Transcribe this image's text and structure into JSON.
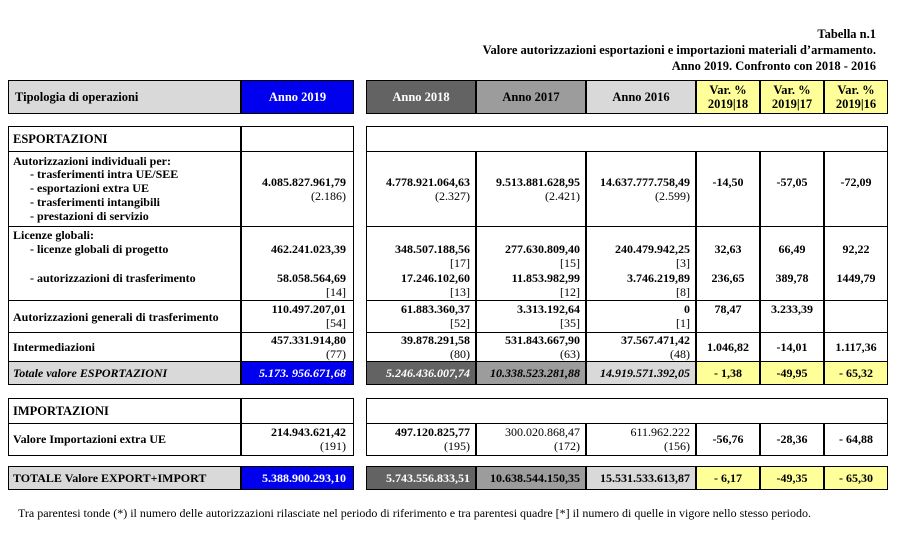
{
  "heading": {
    "line1": "Tabella n.1",
    "line2": "Valore autorizzazioni esportazioni e importazioni materiali d’armamento.",
    "line3": "Anno 2019. Confronto con 2018 - 2016"
  },
  "columns": {
    "label": "Tipologia di operazioni",
    "y2019": "Anno 2019",
    "y2018": "Anno 2018",
    "y2017": "Anno 2017",
    "y2016": "Anno 2016",
    "v18a": "Var. %",
    "v18b": "2019|18",
    "v17a": "Var. %",
    "v17b": "2019|17",
    "v16a": "Var. %",
    "v16b": "2019|16"
  },
  "colors": {
    "blue": "#0000ee",
    "dark_gray": "#636363",
    "mid_gray": "#9c9c9c",
    "light_gray": "#d9d9d9",
    "yellow": "#ffff99"
  },
  "export": {
    "section": "ESPORTAZIONI",
    "indiv": {
      "title": "Autorizzazioni individuali per:",
      "items": [
        "- trasferimenti intra UE/SEE",
        "- esportazioni extra UE",
        "- trasferimenti intangibili",
        "- prestazioni di servizio"
      ],
      "y2019": "4.085.827.961,79",
      "n2019": "(2.186)",
      "y2018": "4.778.921.064,63",
      "n2018": "(2.327)",
      "y2017": "9.513.881.628,95",
      "n2017": "(2.421)",
      "y2016": "14.637.777.758,49",
      "n2016": "(2.599)",
      "v18": "-14,50",
      "v17": "-57,05",
      "v16": "-72,09"
    },
    "licenze": {
      "title": "Licenze globali:",
      "progetto": {
        "label": "- licenze globali di progetto",
        "y2019": "462.241.023,39",
        "y2018": "348.507.188,56",
        "n2018": "[17]",
        "y2017": "277.630.809,40",
        "n2017": "[15]",
        "y2016": "240.479.942,25",
        "n2016": "[8]",
        "n2016b": "[3]",
        "v18": "32,63",
        "v17": "66,49",
        "v16": "92,22"
      },
      "trasf": {
        "label": "- autorizzazioni di trasferimento",
        "y2019": "58.058.564,69",
        "n2019": "[14]",
        "y2018": "17.246.102,60",
        "n2018": "[13]",
        "y2017": "11.853.982,99",
        "n2017": "[12]",
        "y2016": "3.746.219,89",
        "n2016": "[8]",
        "v18": "236,65",
        "v17": "389,78",
        "v16": "1449,79"
      }
    },
    "generali": {
      "label": "Autorizzazioni generali di trasferimento",
      "y2019": "110.497.207,01",
      "n2019": "[54]",
      "y2018": "61.883.360,37",
      "n2018": "[52]",
      "y2017": "3.313.192,64",
      "n2017": "[35]",
      "y2016": "0",
      "n2016": "[1]",
      "v18": "78,47",
      "v17": "3.233,39",
      "v16": ""
    },
    "intermed": {
      "label": "Intermediazioni",
      "y2019": "457.331.914,80",
      "n2019": "(77)",
      "y2018": "39.878.291,58",
      "n2018": "(80)",
      "y2017": "531.843.667,90",
      "n2017": "(63)",
      "y2016": "37.567.471,42",
      "n2016": "(48)",
      "v18": "1.046,82",
      "v17": "-14,01",
      "v16": "1.117,36"
    },
    "totale": {
      "label": "Totale valore ESPORTAZIONI",
      "y2019": "5.173. 956.671,68",
      "y2018": "5.246.436.007,74",
      "y2017": "10.338.523.281,88",
      "y2016": "14.919.571.392,05",
      "v18": "- 1,38",
      "v17": "-49,95",
      "v16": "- 65,32"
    }
  },
  "import": {
    "section": "IMPORTAZIONI",
    "label": "Valore Importazioni extra UE",
    "y2019": "214.943.621,42",
    "n2019": "(191)",
    "y2018": "497.120.825,77",
    "n2018": "(195)",
    "y2017": "300.020.868,47",
    "n2017": "(172)",
    "y2016": "611.962.222",
    "n2016": "(156)",
    "v18": "-56,76",
    "v17": "-28,36",
    "v16": "- 64,88"
  },
  "grand": {
    "label": "TOTALE Valore EXPORT+IMPORT",
    "y2019": "5.388.900.293,10",
    "y2018": "5.743.556.833,51",
    "y2017": "10.638.544.150,35",
    "y2016": "15.531.533.613,87",
    "v18": "- 6,17",
    "v17": "-49,35",
    "v16": "- 65,30"
  },
  "footnote": "Tra parentesi tonde (*) il numero delle autorizzazioni rilasciate nel periodo di riferimento e tra parentesi quadre [*] il numero di quelle in vigore nello stesso periodo."
}
